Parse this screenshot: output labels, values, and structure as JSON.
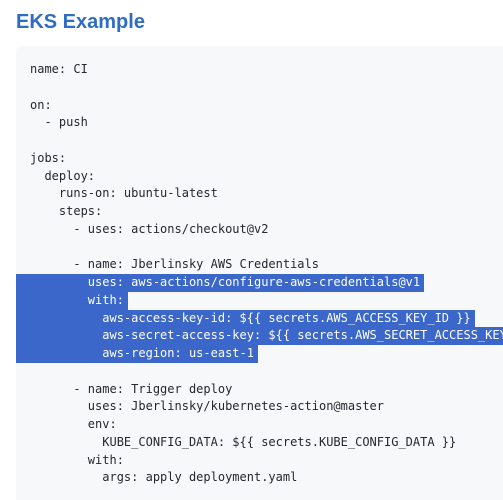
{
  "page": {
    "heading": "EKS Example"
  },
  "code": {
    "lines": [
      {
        "text": "name: CI",
        "selection": "none"
      },
      {
        "text": "",
        "selection": "none"
      },
      {
        "text": "on:",
        "selection": "none"
      },
      {
        "text": "  - push",
        "selection": "none"
      },
      {
        "text": "",
        "selection": "none"
      },
      {
        "text": "jobs:",
        "selection": "none"
      },
      {
        "text": "  deploy:",
        "selection": "none"
      },
      {
        "text": "    runs-on: ubuntu-latest",
        "selection": "none"
      },
      {
        "text": "    steps:",
        "selection": "none"
      },
      {
        "text": "      - uses: actions/checkout@v2",
        "selection": "none"
      },
      {
        "text": "",
        "selection": "none"
      },
      {
        "text": "      - name: Jberlinsky AWS Credentials",
        "selection": "none"
      },
      {
        "text": "        uses: aws-actions/configure-aws-credentials@v1",
        "selection": "full"
      },
      {
        "text": "        with:",
        "selection": "full"
      },
      {
        "text": "          aws-access-key-id: ${{ secrets.AWS_ACCESS_KEY_ID }}",
        "selection": "full"
      },
      {
        "text": "          aws-secret-access-key: ${{ secrets.AWS_SECRET_ACCESS_KEY }}",
        "selection": "full"
      },
      {
        "text": "          aws-region: us-east-1",
        "selection": "full"
      },
      {
        "text": "",
        "selection": "none"
      },
      {
        "text": "      - name: Trigger deploy",
        "selection": "none"
      },
      {
        "text": "        uses: Jberlinsky/kubernetes-action@master",
        "selection": "none"
      },
      {
        "text": "        env:",
        "selection": "none"
      },
      {
        "text": "          KUBE_CONFIG_DATA: ${{ secrets.KUBE_CONFIG_DATA }}",
        "selection": "none"
      },
      {
        "text": "        with:",
        "selection": "none"
      },
      {
        "text": "          args: apply deployment.yaml",
        "selection": "none"
      }
    ]
  },
  "colors": {
    "heading": "#2f6cc4",
    "code_background": "#f6f8fa",
    "code_text": "#24292e",
    "selection_background": "#3a67c9",
    "selection_text": "#ffffff"
  }
}
